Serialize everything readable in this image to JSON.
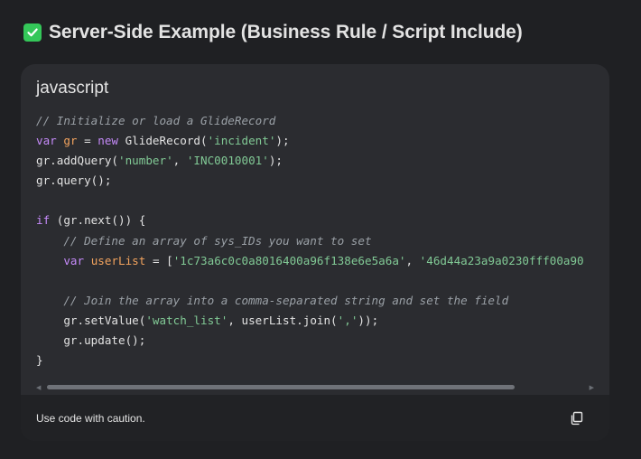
{
  "heading": {
    "icon": "check-mark-icon",
    "text": "Server-Side Example (Business Rule / Script Include)"
  },
  "code_block": {
    "language": "javascript",
    "lines": [
      [
        {
          "t": "comment",
          "v": "// Initialize or load a GlideRecord"
        }
      ],
      [
        {
          "t": "kw",
          "v": "var"
        },
        {
          "t": "plain",
          "v": " "
        },
        {
          "t": "var",
          "v": "gr"
        },
        {
          "t": "plain",
          "v": " = "
        },
        {
          "t": "kw",
          "v": "new"
        },
        {
          "t": "plain",
          "v": " GlideRecord("
        },
        {
          "t": "str",
          "v": "'incident'"
        },
        {
          "t": "plain",
          "v": ");"
        }
      ],
      [
        {
          "t": "plain",
          "v": "gr.addQuery("
        },
        {
          "t": "str",
          "v": "'number'"
        },
        {
          "t": "plain",
          "v": ", "
        },
        {
          "t": "str",
          "v": "'INC0010001'"
        },
        {
          "t": "plain",
          "v": ");"
        }
      ],
      [
        {
          "t": "plain",
          "v": "gr.query();"
        }
      ],
      [
        {
          "t": "plain",
          "v": ""
        }
      ],
      [
        {
          "t": "kw",
          "v": "if"
        },
        {
          "t": "plain",
          "v": " (gr.next()) {"
        }
      ],
      [
        {
          "t": "plain",
          "v": "    "
        },
        {
          "t": "comment",
          "v": "// Define an array of sys_IDs you want to set"
        }
      ],
      [
        {
          "t": "plain",
          "v": "    "
        },
        {
          "t": "kw",
          "v": "var"
        },
        {
          "t": "plain",
          "v": " "
        },
        {
          "t": "var",
          "v": "userList"
        },
        {
          "t": "plain",
          "v": " = ["
        },
        {
          "t": "str",
          "v": "'1c73a6c0c0a8016400a96f138e6e5a6a'"
        },
        {
          "t": "plain",
          "v": ", "
        },
        {
          "t": "str",
          "v": "'46d44a23a9a0230fff00a90"
        }
      ],
      [
        {
          "t": "plain",
          "v": ""
        }
      ],
      [
        {
          "t": "plain",
          "v": "    "
        },
        {
          "t": "comment",
          "v": "// Join the array into a comma-separated string and set the field"
        }
      ],
      [
        {
          "t": "plain",
          "v": "    gr.setValue("
        },
        {
          "t": "str",
          "v": "'watch_list'"
        },
        {
          "t": "plain",
          "v": ", userList.join("
        },
        {
          "t": "str",
          "v": "','"
        },
        {
          "t": "plain",
          "v": "));"
        }
      ],
      [
        {
          "t": "plain",
          "v": "    gr.update();"
        }
      ],
      [
        {
          "t": "plain",
          "v": "}"
        }
      ]
    ]
  },
  "scrollbar": {
    "left_arrow": "◀",
    "right_arrow": "▶"
  },
  "footer": {
    "caution_text": "Use code with caution.",
    "copy_icon": "copy-icon"
  }
}
